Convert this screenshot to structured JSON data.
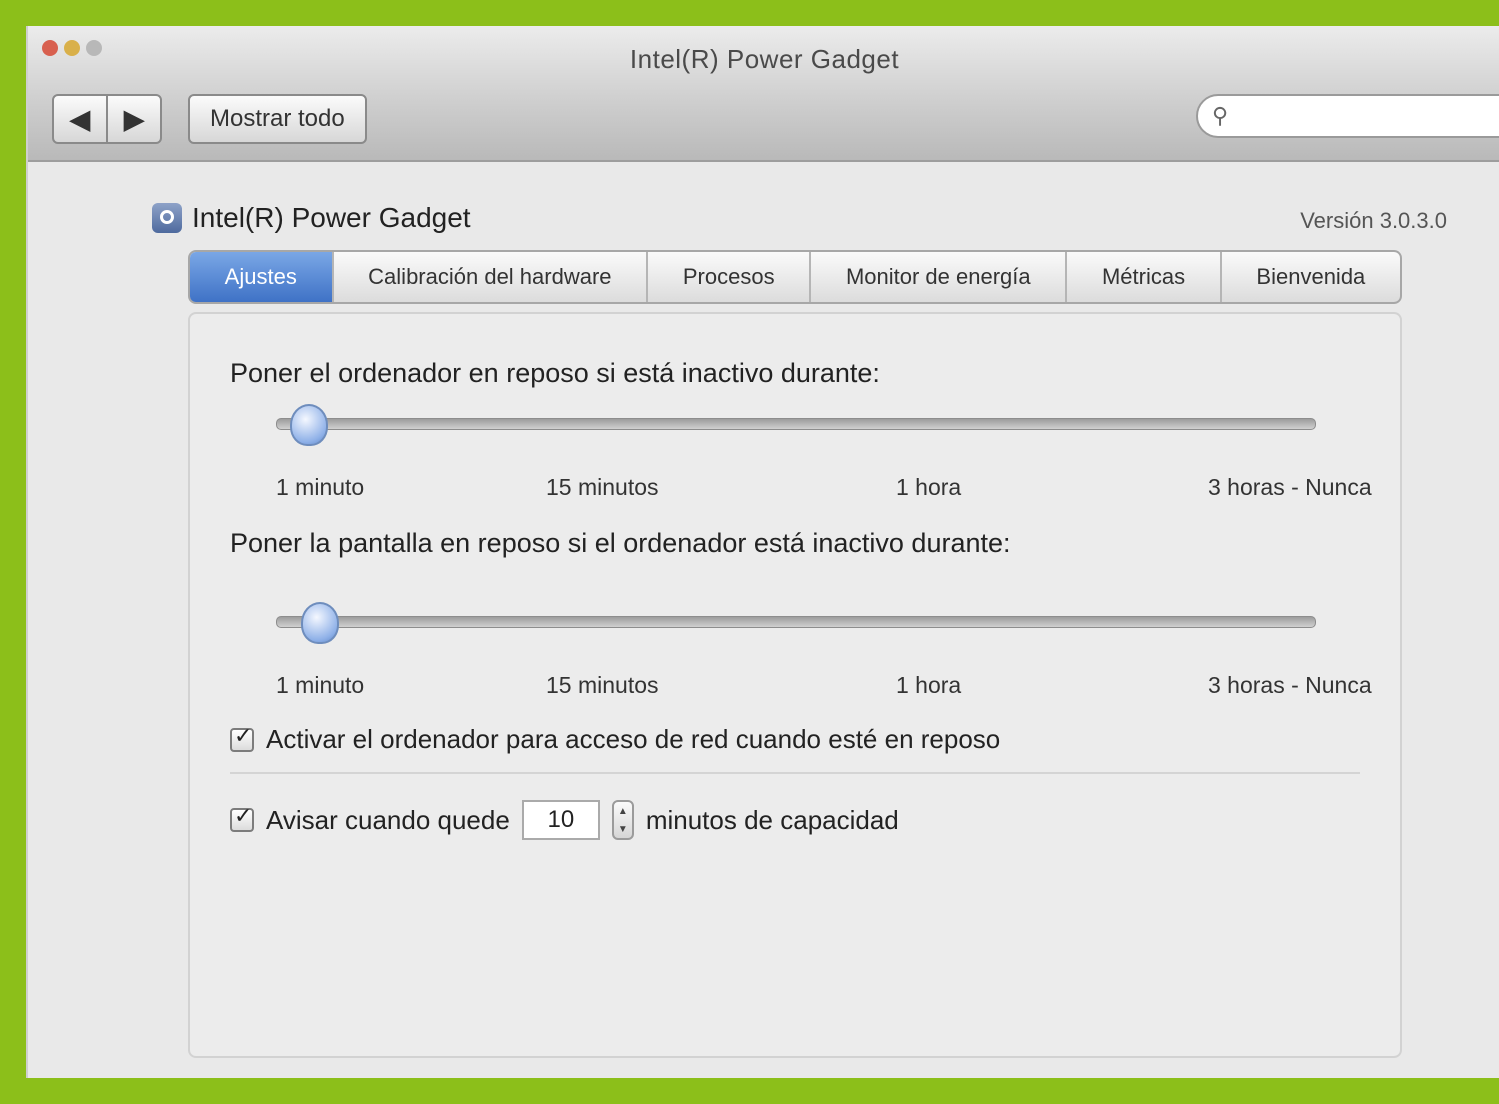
{
  "window": {
    "title": "Intel(R) Power Gadget",
    "nav_back": "◀",
    "nav_forward": "▶",
    "show_all": "Mostrar todo",
    "search_placeholder": ""
  },
  "pref_pane": {
    "title": "Intel(R) Power Gadget",
    "version": "Versión 3.0.3.0"
  },
  "tabs": [
    {
      "label": "Ajustes",
      "active": true
    },
    {
      "label": "Calibración del hardware",
      "active": false
    },
    {
      "label": "Procesos",
      "active": false
    },
    {
      "label": "Monitor de energía",
      "active": false
    },
    {
      "label": "Métricas",
      "active": false
    },
    {
      "label": "Bienvenida",
      "active": false
    }
  ],
  "settings": {
    "sleep_computer_label": "Poner el ordenador en reposo si está inactivo durante:",
    "sleep_computer_value_fraction": 0.03,
    "sleep_display_label": "Poner la pantalla en reposo si el ordenador está inactivo durante:",
    "sleep_display_value_fraction": 0.04,
    "ticks": [
      "1 minuto",
      "15 minutos",
      "1 hora",
      "3 horas - Nunca"
    ],
    "wake_option_label": "Activar el ordenador para acceso de red cuando esté en reposo",
    "wake_option_checked": true,
    "threshold_label_before": "Avisar cuando quede",
    "threshold_value": "10",
    "threshold_label_after": "minutos de capacidad",
    "threshold_checked": true
  },
  "colors": {
    "accent": "#4a7fd0",
    "background": "#8cbf1a"
  }
}
